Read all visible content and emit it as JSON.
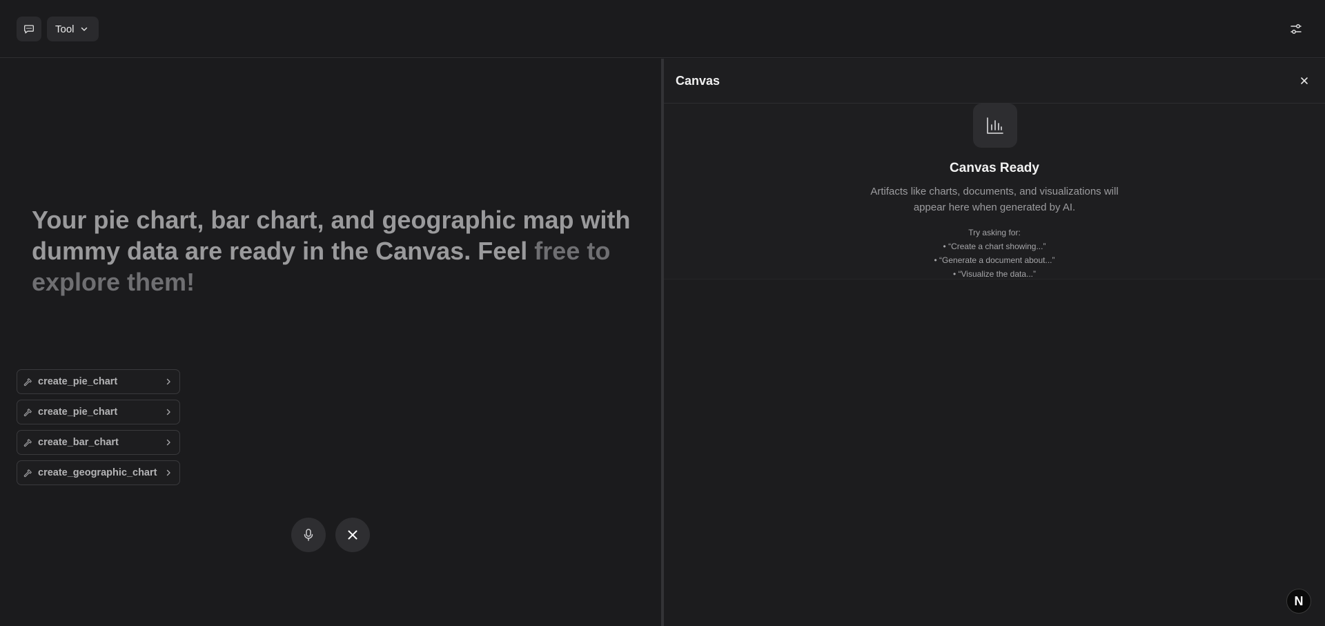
{
  "header": {
    "tool_label": "Tool",
    "icons": {
      "chat": "chat-icon",
      "dropdown": "chevron-down-icon",
      "settings": "sliders-icon"
    }
  },
  "chat": {
    "message_main": "Your pie chart, bar chart, and geographic map with dummy data are ready in the Canvas. Feel",
    "message_fade": "free to explore them!",
    "tool_calls": [
      {
        "label": "create_pie_chart"
      },
      {
        "label": "create_pie_chart"
      },
      {
        "label": "create_bar_chart"
      },
      {
        "label": "create_geographic_chart"
      }
    ],
    "controls": {
      "mic": "microphone-icon",
      "close": "close-icon"
    }
  },
  "canvas": {
    "title": "Canvas",
    "ready_title": "Canvas Ready",
    "description": "Artifacts like charts, documents, and visualizations will appear here when generated by AI.",
    "try_heading": "Try asking for:",
    "suggestions": [
      "• “Create a chart showing...”",
      "• “Generate a document about...”",
      "• “Visualize the data...”"
    ],
    "tile_icon": "bar-chart-icon"
  },
  "badge": {
    "letter": "N"
  },
  "colors": {
    "background": "#1b1b1d",
    "panel": "#1e1e20",
    "button": "#2a2a2d",
    "accent_text": "#f2f2f2"
  }
}
